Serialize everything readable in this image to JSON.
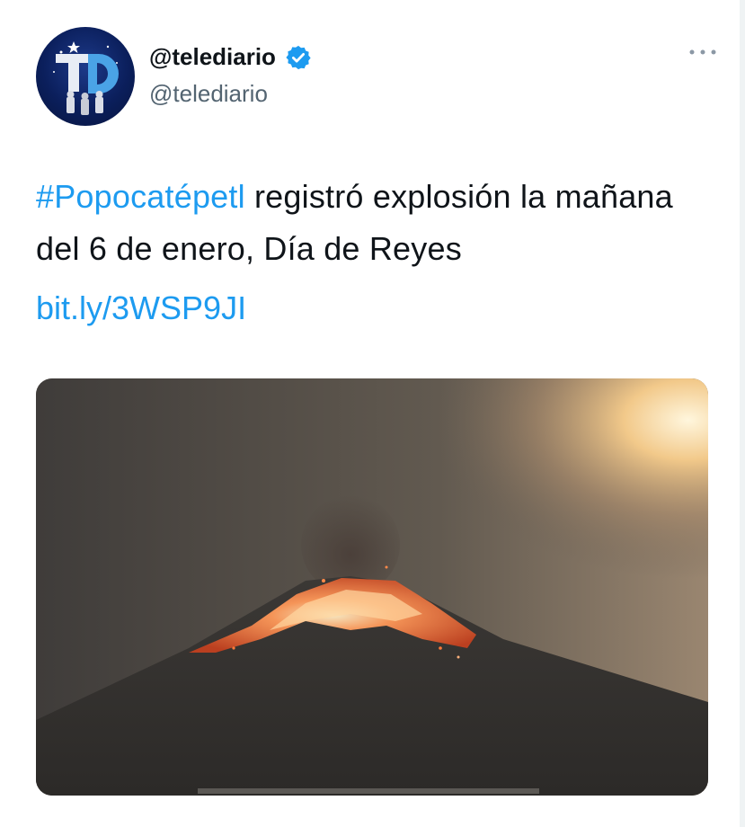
{
  "user": {
    "display_name": "@telediario",
    "handle": "@telediario",
    "avatar_letters": "TD",
    "verified": true
  },
  "tweet": {
    "hashtag": "#Popocatépetl",
    "text_rest": " registró explosión la mañana del 6 de enero, Día de Reyes",
    "link": "bit.ly/3WSP9JI"
  },
  "icons": {
    "verified": "verified-badge-icon",
    "more": "more-options-icon"
  },
  "colors": {
    "link": "#1d9bf0",
    "text": "#0f1419",
    "secondary": "#536471",
    "verified": "#1d9bf0"
  }
}
